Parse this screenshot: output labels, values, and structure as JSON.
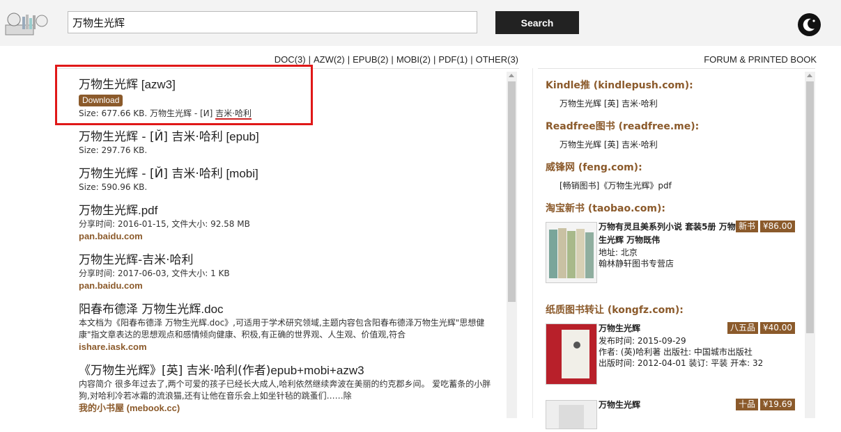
{
  "search": {
    "value": "万物生光辉",
    "button_label": "Search"
  },
  "filters": [
    {
      "label": "DOC(3)"
    },
    {
      "label": "AZW(2)"
    },
    {
      "label": "EPUB(2)"
    },
    {
      "label": "MOBI(2)"
    },
    {
      "label": "PDF(1)"
    },
    {
      "label": "OTHER(3)"
    }
  ],
  "filter_separator": "|",
  "forum_heading": "FORUM & PRINTED BOOK",
  "results": [
    {
      "title": "万物生光辉",
      "format": " [azw3]",
      "download": "Download",
      "meta_prefix": "Size: 677.66 KB. 万物生光辉 - [И] ",
      "meta_author": "吉米·哈利"
    },
    {
      "title": "万物生光辉 - [Й] 吉米·哈利",
      "format": " [epub]",
      "meta": "Size: 297.76 KB."
    },
    {
      "title": "万物生光辉 - [Й] 吉米·哈利",
      "format": " [mobi]",
      "meta": "Size: 590.96 KB."
    },
    {
      "title": "万物生光辉",
      "format": ".pdf",
      "meta": "分享时间: 2016-01-15, 文件大小: 92.58 MB",
      "source": "pan.baidu.com"
    },
    {
      "title": "万物生光辉-吉米·哈利",
      "format": "",
      "meta": "分享时间: 2017-06-03, 文件大小: 1 KB",
      "source": "pan.baidu.com"
    },
    {
      "title": "阳春布德泽 万物生光辉",
      "format": ".doc",
      "meta": "本文档为《阳春布德泽 万物生光辉.doc》,可适用于学术研究领域,主题内容包含阳春布德泽万物生光辉\"思想健康\"指文章表达的思想观点和感情倾向健康、积极,有正确的世界观、人生观、价值观,符合",
      "source": "ishare.iask.com"
    },
    {
      "title": "《万物生光辉》[英] 吉米·哈利(作者)",
      "format": "epub+mobi+azw3",
      "meta": "内容简介    很多年过去了,两个可爱的孩子已经长大成人,哈利依然继续奔波在美丽的约克郡乡间。    爱吃蓄条的小胖狗,对哈利冷若冰霜的流浪猫,还有让他在音乐会上如坐针毡的跳蚤们……除",
      "source": "我的小书屋 (mebook.cc)"
    }
  ],
  "sidebar": {
    "sections": [
      {
        "heading": "Kindle推 (kindlepush.com):",
        "item": "万物生光辉 [英] 吉米·哈利"
      },
      {
        "heading": "Readfree图书 (readfree.me):",
        "item": "万物生光辉 [英] 吉米·哈利"
      },
      {
        "heading": "威锋网 (feng.com):",
        "item": "[畅销图书]《万物生光辉》pdf"
      }
    ],
    "taobao": {
      "heading": "淘宝新书 (taobao.com):",
      "title": "万物有灵且美系列小说 套装5册 万物生光辉 万物既伟",
      "line1": "地址: 北京",
      "line2": "翰林静轩图书专营店",
      "condition": "新书",
      "price": "¥86.00"
    },
    "kongfz": {
      "heading": "纸质图书转让 (kongfz.com):",
      "items": [
        {
          "title": "万物生光辉",
          "line1": "发布时间: 2015-09-29",
          "line2": "作者: (英)哈利著 出版社: 中国城市出版社",
          "line3": "出版时间: 2012-04-01 装订: 平装 开本: 32",
          "condition": "八五品",
          "price": "¥40.00"
        },
        {
          "title": "万物生光辉",
          "condition": "十品",
          "price": "¥19.69"
        }
      ]
    }
  },
  "colors": {
    "accent": "#8b5a2b",
    "highlight": "#e01818",
    "search_button": "#222222"
  }
}
